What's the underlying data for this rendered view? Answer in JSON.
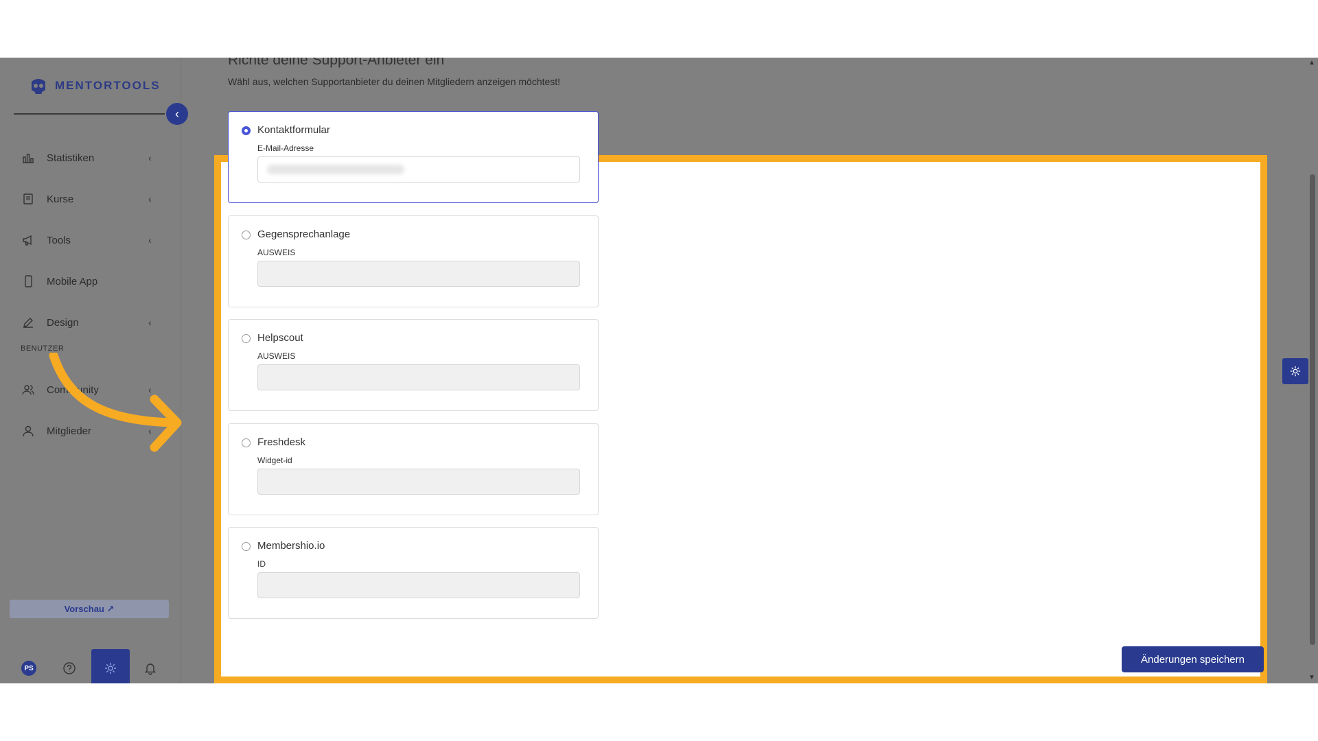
{
  "brand": {
    "name": "MENTORTOOLS"
  },
  "sidebar": {
    "collapse_glyph": "‹",
    "items": [
      {
        "label": "Statistiken",
        "icon": "bar-chart-icon",
        "has_chevron": true
      },
      {
        "label": "Kurse",
        "icon": "book-icon",
        "has_chevron": true
      },
      {
        "label": "Tools",
        "icon": "megaphone-icon",
        "has_chevron": true
      },
      {
        "label": "Mobile App",
        "icon": "phone-icon",
        "has_chevron": false
      },
      {
        "label": "Design",
        "icon": "pencil-icon",
        "has_chevron": true
      }
    ],
    "section_label": "BENUTZER",
    "user_items": [
      {
        "label": "Community",
        "icon": "people-icon",
        "has_chevron": true
      },
      {
        "label": "Mitglieder",
        "icon": "user-icon",
        "has_chevron": true
      }
    ],
    "chevron": "‹",
    "preview_label": "Vorschau ↗",
    "avatar_initials": "PS"
  },
  "main": {
    "title": "Richte deine Support-Anbieter ein",
    "subtitle": "Wähl aus, welchen Supportanbieter du deinen Mitgliedern anzeigen möchtest!",
    "providers": [
      {
        "name": "Kontaktformular",
        "field_label": "E-Mail-Adresse",
        "selected": true
      },
      {
        "name": "Gegensprechanlage",
        "field_label": "AUSWEIS",
        "selected": false
      },
      {
        "name": "Helpscout",
        "field_label": "AUSWEIS",
        "selected": false
      },
      {
        "name": "Freshdesk",
        "field_label": "Widget-id",
        "selected": false
      },
      {
        "name": "Membershio.io",
        "field_label": "ID",
        "selected": false
      }
    ],
    "save_label": "Änderungen speichern"
  },
  "colors": {
    "brand_blue": "#2a3b8f",
    "radio_blue": "#4953d6",
    "highlight_orange": "#f7ab22",
    "overlay_gray": "#808080"
  }
}
